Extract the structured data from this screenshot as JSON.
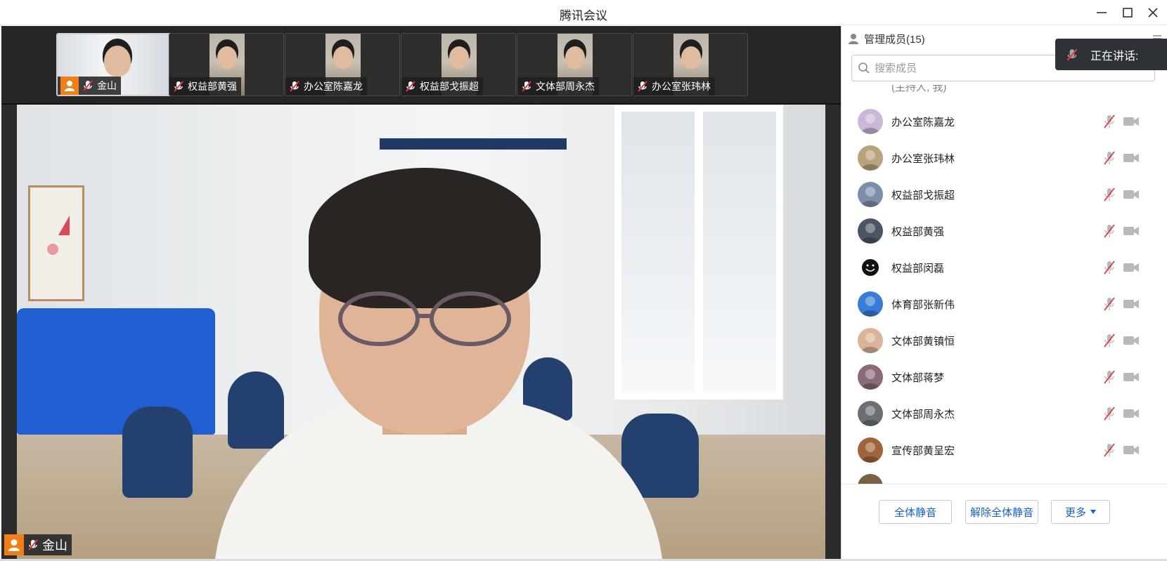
{
  "window": {
    "title": "腾讯会议"
  },
  "thumbnails": [
    {
      "name": "金山",
      "host": true
    },
    {
      "name": "权益部黄强",
      "host": false
    },
    {
      "name": "办公室陈嘉龙",
      "host": false
    },
    {
      "name": "权益部戈振超",
      "host": false
    },
    {
      "name": "文体部周永杰",
      "host": false
    },
    {
      "name": "办公室张玮林",
      "host": false
    }
  ],
  "main_video": {
    "speaker_name": "金山"
  },
  "panel": {
    "title": "管理成员(15)",
    "search_placeholder": "搜索成员",
    "speaking_label": "正在讲话:",
    "partial_top_text": "(主持人, 我)",
    "members": [
      {
        "name": "办公室陈嘉龙",
        "avatar_color": "#c9b8d8"
      },
      {
        "name": "办公室张玮林",
        "avatar_color": "#b9a27c"
      },
      {
        "name": "权益部戈振超",
        "avatar_color": "#7d8fa8"
      },
      {
        "name": "权益部黄强",
        "avatar_color": "#4b5563"
      },
      {
        "name": "权益部闵磊",
        "avatar_color": "#ffffff"
      },
      {
        "name": "体育部张新伟",
        "avatar_color": "#3a7bd5"
      },
      {
        "name": "文体部黄镇恒",
        "avatar_color": "#d9b49a"
      },
      {
        "name": "文体部蒋梦",
        "avatar_color": "#8a6a78"
      },
      {
        "name": "文体部周永杰",
        "avatar_color": "#6b6f74"
      },
      {
        "name": "宣传部黄呈宏",
        "avatar_color": "#a0643a"
      }
    ],
    "buttons": {
      "mute_all": "全体静音",
      "unmute_all": "解除全体静音",
      "more": "更多"
    }
  },
  "colors": {
    "accent": "#1560c8",
    "host_badge": "#f07f18",
    "muted_red": "#e0393e"
  }
}
